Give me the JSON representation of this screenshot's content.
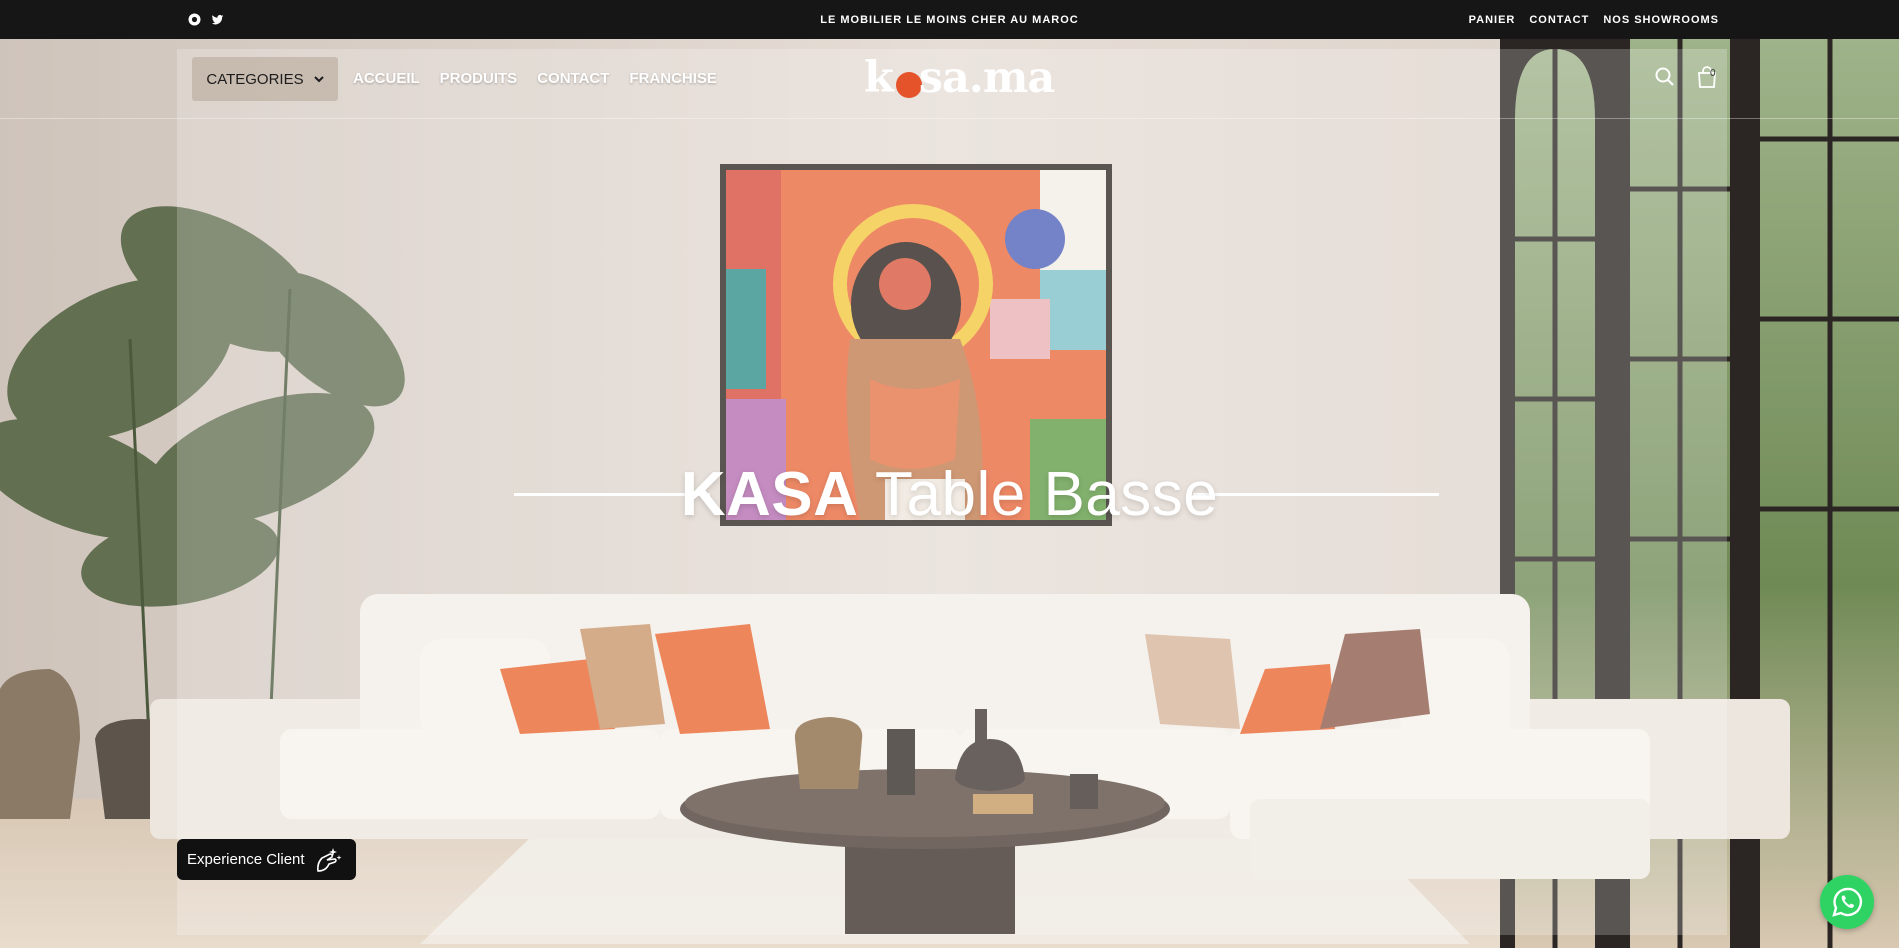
{
  "topbar": {
    "social": [
      "instagram-icon",
      "twitter-icon"
    ],
    "tagline": "LE MOBILIER LE MOINS CHER AU MAROC",
    "links": [
      "PANIER",
      "CONTACT",
      "NOS SHOWROOMS"
    ]
  },
  "header": {
    "categories_label": "CATEGORIES",
    "nav": [
      "ACCUEIL",
      "PRODUITS",
      "CONTACT",
      "FRANCHISE"
    ],
    "logo": {
      "prefix": "k",
      "suffix": "sa.ma"
    },
    "icons": [
      "search-icon",
      "cart-icon"
    ],
    "cart_count": "0"
  },
  "hero": {
    "title_bold": "KASA",
    "title_light": " Table Basse"
  },
  "widgets": {
    "experience_label": "Experience Client",
    "whatsapp_icon": "whatsapp-icon"
  },
  "colors": {
    "topbar_bg": "#161616",
    "logo_accent": "#e4532a",
    "whatsapp": "#2fd364",
    "cushion_orange": "#e8642e"
  }
}
